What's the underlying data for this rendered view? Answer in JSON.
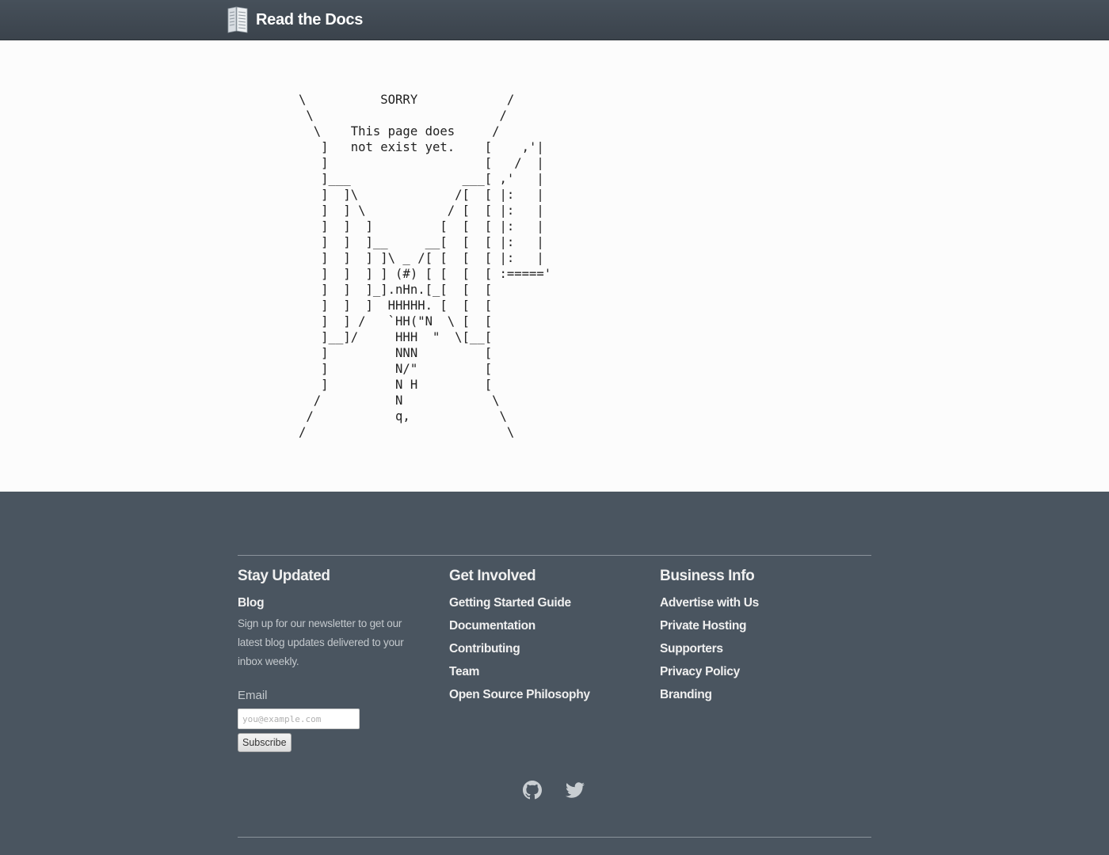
{
  "header": {
    "brand": "Read the Docs"
  },
  "error_page": {
    "ascii_art": "\\          SORRY            /\n \\                         /\n  \\    This page does     /\n   ]   not exist yet.    [    ,'|\n   ]                     [   /  |\n   ]___               ___[ ,'   |\n   ]  ]\\             /[  [ |:   |\n   ]  ] \\           / [  [ |:   |\n   ]  ]  ]         [  [  [ |:   |\n   ]  ]  ]__     __[  [  [ |:   |\n   ]  ]  ] ]\\ _ /[ [  [  [ |:   |\n   ]  ]  ] ] (#) [ [  [  [ :====='\n   ]  ]  ]_].nHn.[_[  [  [\n   ]  ]  ]  HHHHH. [  [  [\n   ]  ] /   `HH(\"N  \\ [  [\n   ]__]/     HHH  \"  \\[__[\n   ]         NNN         [\n   ]         N/\"         [\n   ]         N H         [\n  /          N            \\\n /           q,            \\\n/                           \\"
  },
  "footer": {
    "stay_updated": {
      "heading": "Stay Updated",
      "blog": "Blog",
      "newsletter_text": "Sign up for our newsletter to get our latest blog updates delivered to your inbox weekly.",
      "email_label": "Email",
      "email_placeholder": "you@example.com",
      "subscribe": "Subscribe"
    },
    "get_involved": {
      "heading": "Get Involved",
      "links": [
        "Getting Started Guide",
        "Documentation",
        "Contributing",
        "Team",
        "Open Source Philosophy"
      ]
    },
    "business_info": {
      "heading": "Business Info",
      "links": [
        "Advertise with Us",
        "Private Hosting",
        "Supporters",
        "Privacy Policy",
        "Branding"
      ]
    },
    "social": [
      "github-icon",
      "twitter-icon"
    ]
  }
}
